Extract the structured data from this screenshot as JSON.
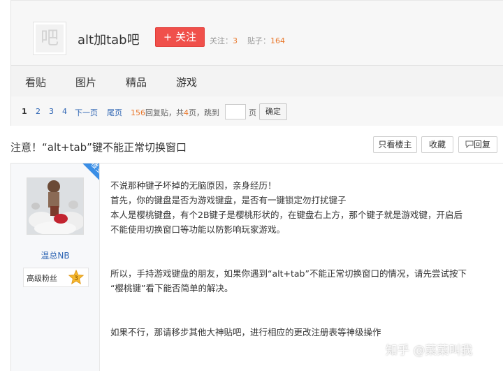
{
  "forum": {
    "avatar_char": "吧",
    "name": "alt加tab吧",
    "follow_label": "+ 关注",
    "follow_count_label": "关注：",
    "follow_count": "3",
    "post_count_label": "贴子：",
    "post_count": "164"
  },
  "nav": {
    "items": [
      "看贴",
      "图片",
      "精品",
      "游戏"
    ]
  },
  "pager": {
    "pages": [
      "1",
      "2",
      "3",
      "4"
    ],
    "next": "下一页",
    "last": "尾页",
    "reply_count": "156",
    "reply_text": "回复贴，共",
    "page_total": "4",
    "page_text": "页，",
    "jump_text": "跳到",
    "page_unit": "页",
    "confirm": "确定"
  },
  "thread": {
    "title": "注意！“alt+tab”键不能正常切换窗口",
    "only_op": "只看楼主",
    "favorite": "收藏",
    "reply": "回复",
    "reply_icon": "speech-bubble-icon"
  },
  "author": {
    "badge": "楼主",
    "name": "温总NB",
    "level_title": "高级粉丝",
    "level": "3"
  },
  "post": {
    "lines": [
      "不说那种键子坏掉的无脑原因，亲身经历！",
      "首先，你的键盘是否为游戏键盘，是否有一键锁定勿打扰键子",
      "本人是樱桃键盘，有个2B键子是樱桃形状的，在键盘右上方，那个键子就是游戏键，开启后",
      "不能使用切换窗口等功能以防影响玩家游戏。",
      "所以，手持游戏键盘的朋友，如果你遇到“alt+tab”不能正常切换窗口的情况，请先尝试按下",
      "“樱桃键”看下能否简单的解决。",
      "如果不行，那请移步其他大神贴吧，进行相应的更改注册表等神级操作"
    ]
  },
  "watermark": "知乎 @菜菜叫我",
  "colors": {
    "follow": "#f0504b",
    "link": "#2d64b3",
    "orange": "#e9772b",
    "badge": "#3a8ee6"
  }
}
